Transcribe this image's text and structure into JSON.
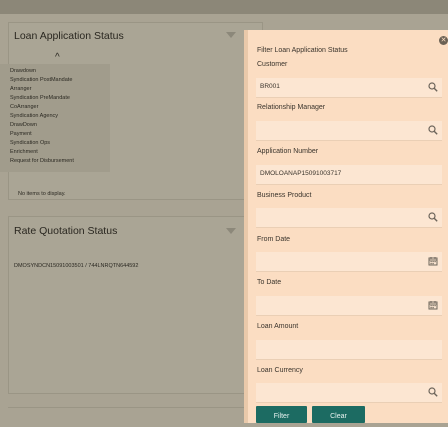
{
  "loan_panel": {
    "title": "Loan Application Status",
    "menu_items": [
      "Drawdown",
      "Syndication PostMandate",
      "Arranger",
      "Syndication PreMandate",
      "CoArranger",
      "Syndication Agency",
      "DrawDown",
      "Payment",
      "Syndication Ops",
      "Enrichment",
      "Request for Disbursement"
    ],
    "empty_text": "No items to display."
  },
  "rate_panel": {
    "title": "Rate Quotation Status",
    "row_text": "DMOSYNDCN15091003501 / 744LNRQTN644592"
  },
  "drawer": {
    "title": "Filter Loan Application Status",
    "fields": [
      {
        "label": "Customer",
        "value": "BR001",
        "icon": "search-icon"
      },
      {
        "label": "Relationship Manager",
        "value": "",
        "icon": "search-icon"
      },
      {
        "label": "Application Number",
        "value": "DMOLOANAP15091003717",
        "icon": ""
      },
      {
        "label": "Business Product",
        "value": "",
        "icon": "search-icon"
      },
      {
        "label": "From Date",
        "value": "",
        "icon": "calendar-icon"
      },
      {
        "label": "To Date",
        "value": "",
        "icon": "calendar-icon"
      },
      {
        "label": "Loan Amount",
        "value": "",
        "icon": ""
      },
      {
        "label": "Loan Currency",
        "value": "",
        "icon": "search-icon"
      }
    ],
    "filter_label": "Filter",
    "clear_label": "Clear"
  }
}
